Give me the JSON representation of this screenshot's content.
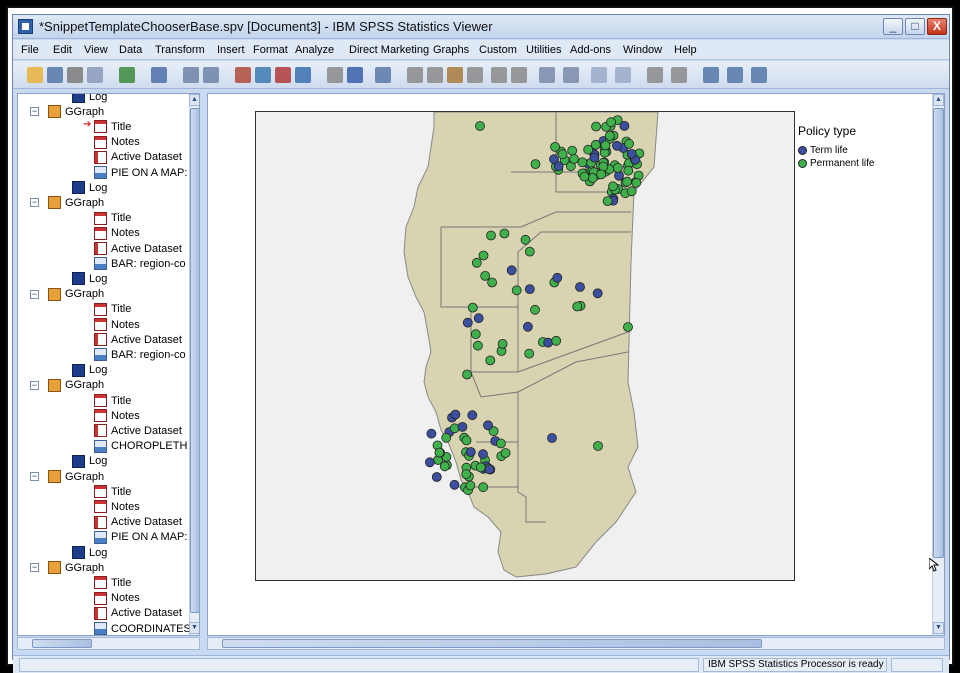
{
  "window": {
    "title": "*SnippetTemplateChooserBase.spv [Document3] - IBM SPSS Statistics Viewer",
    "minimize_label": "_",
    "maximize_label": "□",
    "close_label": "X"
  },
  "menubar": {
    "items": [
      "File",
      "Edit",
      "View",
      "Data",
      "Transform",
      "Insert",
      "Format",
      "Analyze",
      "Direct Marketing",
      "Graphs",
      "Custom",
      "Utilities",
      "Add-ons",
      "Window",
      "Help"
    ]
  },
  "toolbar": {
    "icons": [
      "open-icon",
      "save-icon",
      "print-icon",
      "print-preview-icon",
      "export-icon",
      "recall-dialog-icon",
      "undo-icon",
      "redo-icon",
      "goto-data-icon",
      "goto-case-icon",
      "goto-variable-icon",
      "variables-icon",
      "designate-window-icon",
      "select-output-icon",
      "insert-icon",
      "promote-icon",
      "demote-icon",
      "collapse-icon",
      "expand-icon",
      "show-icon",
      "hide-icon",
      "back-icon",
      "forward-icon",
      "add-icon",
      "remove-icon",
      "tree-icon",
      "table-icon",
      "output-icon",
      "syntax-icon",
      "data-icon"
    ]
  },
  "outline": {
    "rows": [
      {
        "label": "Log",
        "type": "log",
        "level": 1
      },
      {
        "label": "GGraph",
        "type": "ggraph",
        "level": 0
      },
      {
        "label": "Title",
        "type": "title",
        "level": 2,
        "current": true
      },
      {
        "label": "Notes",
        "type": "notes",
        "level": 2
      },
      {
        "label": "Active Dataset",
        "type": "dataset",
        "level": 2
      },
      {
        "label": "PIE ON A MAP:",
        "type": "chart",
        "level": 2
      },
      {
        "label": "Log",
        "type": "log",
        "level": 1
      },
      {
        "label": "GGraph",
        "type": "ggraph",
        "level": 0
      },
      {
        "label": "Title",
        "type": "title",
        "level": 2
      },
      {
        "label": "Notes",
        "type": "notes",
        "level": 2
      },
      {
        "label": "Active Dataset",
        "type": "dataset",
        "level": 2
      },
      {
        "label": "BAR: region-co",
        "type": "chart",
        "level": 2
      },
      {
        "label": "Log",
        "type": "log",
        "level": 1
      },
      {
        "label": "GGraph",
        "type": "ggraph",
        "level": 0
      },
      {
        "label": "Title",
        "type": "title",
        "level": 2
      },
      {
        "label": "Notes",
        "type": "notes",
        "level": 2
      },
      {
        "label": "Active Dataset",
        "type": "dataset",
        "level": 2
      },
      {
        "label": "BAR: region-co",
        "type": "chart",
        "level": 2
      },
      {
        "label": "Log",
        "type": "log",
        "level": 1
      },
      {
        "label": "GGraph",
        "type": "ggraph",
        "level": 0
      },
      {
        "label": "Title",
        "type": "title",
        "level": 2
      },
      {
        "label": "Notes",
        "type": "notes",
        "level": 2
      },
      {
        "label": "Active Dataset",
        "type": "dataset",
        "level": 2
      },
      {
        "label": "CHOROPLETH",
        "type": "chart",
        "level": 2
      },
      {
        "label": "Log",
        "type": "log",
        "level": 1
      },
      {
        "label": "GGraph",
        "type": "ggraph",
        "level": 0
      },
      {
        "label": "Title",
        "type": "title",
        "level": 2
      },
      {
        "label": "Notes",
        "type": "notes",
        "level": 2
      },
      {
        "label": "Active Dataset",
        "type": "dataset",
        "level": 2
      },
      {
        "label": "PIE ON A MAP:",
        "type": "chart",
        "level": 2
      },
      {
        "label": "Log",
        "type": "log",
        "level": 1
      },
      {
        "label": "GGraph",
        "type": "ggraph",
        "level": 0
      },
      {
        "label": "Title",
        "type": "title",
        "level": 2
      },
      {
        "label": "Notes",
        "type": "notes",
        "level": 2
      },
      {
        "label": "Active Dataset",
        "type": "dataset",
        "level": 2
      },
      {
        "label": "COORDINATES",
        "type": "chart",
        "level": 2
      }
    ]
  },
  "chart": {
    "map_fill": "#d8d3b0",
    "map_stroke": "#777",
    "background": "#f0f0f0",
    "legend": {
      "title": "Policy type",
      "items": [
        {
          "label": "Term life",
          "color": "#3c4f9e"
        },
        {
          "label": "Permanent life",
          "color": "#3fb04b"
        }
      ]
    }
  },
  "statusbar": {
    "processor_status": "IBM SPSS Statistics Processor is ready"
  }
}
